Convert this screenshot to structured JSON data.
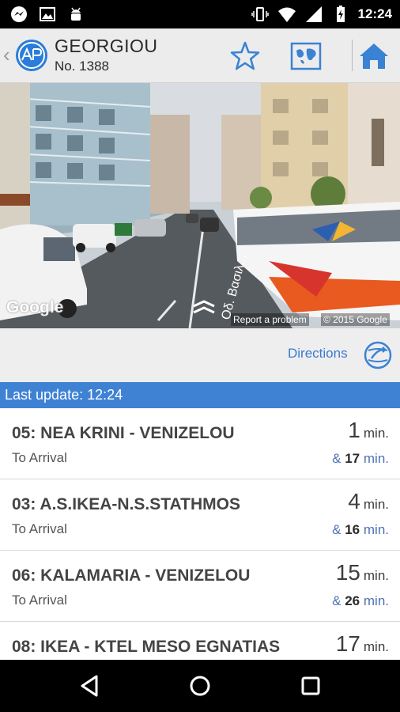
{
  "status_bar": {
    "time": "12:24",
    "left_icons": [
      "messenger-icon",
      "image-icon",
      "android-icon"
    ],
    "right_icons": [
      "vibrate-icon",
      "wifi-icon",
      "signal-icon",
      "battery-icon"
    ]
  },
  "header": {
    "stop_name": "GEORGIOU",
    "stop_number": "No. 1388",
    "back_glyph": "‹"
  },
  "streetview": {
    "watermark": "Google",
    "report_link": "Report a problem",
    "copyright": "© 2015 Google"
  },
  "directions": {
    "label": "Directions"
  },
  "update": {
    "text": "Last update: 12:24"
  },
  "arrivals": [
    {
      "route": "05: NEA KRINI - VENIZELOU",
      "subtitle": "To Arrival",
      "first": "1",
      "first_unit": "min.",
      "second_prefix": "&",
      "second": "17",
      "second_unit": "min."
    },
    {
      "route": "03: A.S.IKEA-N.S.STATHMOS",
      "subtitle": "To Arrival",
      "first": "4",
      "first_unit": "min.",
      "second_prefix": "&",
      "second": "16",
      "second_unit": "min."
    },
    {
      "route": "06: KALAMARIA - VENIZELOU",
      "subtitle": "To Arrival",
      "first": "15",
      "first_unit": "min.",
      "second_prefix": "&",
      "second": "26",
      "second_unit": "min."
    },
    {
      "route": "08: IKEA - KTEL MESO EGNATIAS",
      "subtitle": "",
      "first": "17",
      "first_unit": "min.",
      "second_prefix": "",
      "second": "",
      "second_unit": ""
    }
  ],
  "colors": {
    "accent": "#3f82d4",
    "link": "#3a7bd0"
  }
}
